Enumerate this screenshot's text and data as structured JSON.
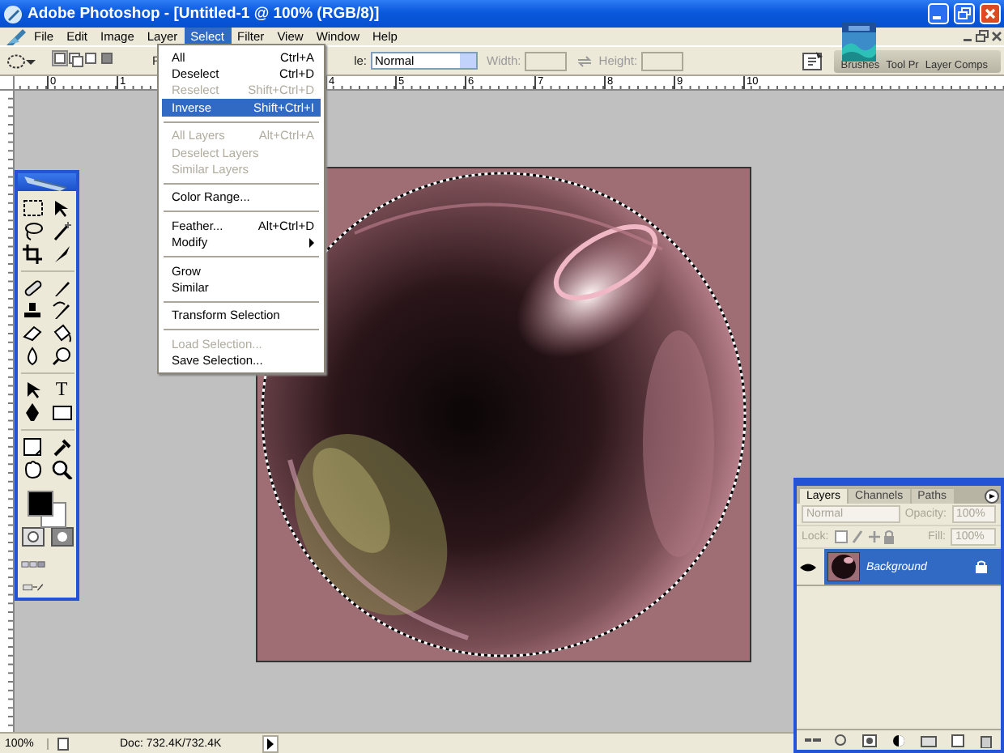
{
  "window": {
    "title": "Adobe Photoshop - [Untitled-1 @ 100% (RGB/8)]"
  },
  "menu_bar": [
    {
      "label": "File",
      "selected": false
    },
    {
      "label": "Edit",
      "selected": false
    },
    {
      "label": "Image",
      "selected": false
    },
    {
      "label": "Layer",
      "selected": false
    },
    {
      "label": "Select",
      "selected": true
    },
    {
      "label": "Filter",
      "selected": false
    },
    {
      "label": "View",
      "selected": false
    },
    {
      "label": "Window",
      "selected": false
    },
    {
      "label": "Help",
      "selected": false
    }
  ],
  "select_menu": [
    {
      "kind": "item",
      "label": "All",
      "shortcut": "Ctrl+A",
      "disabled": false,
      "selected": false
    },
    {
      "kind": "item",
      "label": "Deselect",
      "shortcut": "Ctrl+D",
      "disabled": false,
      "selected": false
    },
    {
      "kind": "item",
      "label": "Reselect",
      "shortcut": "Shift+Ctrl+D",
      "disabled": true,
      "selected": false
    },
    {
      "kind": "item",
      "label": "Inverse",
      "shortcut": "Shift+Ctrl+I",
      "disabled": false,
      "selected": true
    },
    {
      "kind": "separator"
    },
    {
      "kind": "item",
      "label": "All Layers",
      "shortcut": "Alt+Ctrl+A",
      "disabled": true,
      "selected": false
    },
    {
      "kind": "item",
      "label": "Deselect Layers",
      "disabled": true,
      "selected": false
    },
    {
      "kind": "item",
      "label": "Similar Layers",
      "disabled": true,
      "selected": false
    },
    {
      "kind": "separator"
    },
    {
      "kind": "item",
      "label": "Color Range...",
      "disabled": false,
      "selected": false
    },
    {
      "kind": "separator"
    },
    {
      "kind": "item",
      "label": "Feather...",
      "shortcut": "Alt+Ctrl+D",
      "disabled": false,
      "selected": false
    },
    {
      "kind": "item",
      "label": "Modify",
      "submenu": true,
      "disabled": false,
      "selected": false
    },
    {
      "kind": "separator"
    },
    {
      "kind": "item",
      "label": "Grow",
      "disabled": false,
      "selected": false
    },
    {
      "kind": "item",
      "label": "Similar",
      "disabled": false,
      "selected": false
    },
    {
      "kind": "separator"
    },
    {
      "kind": "item",
      "label": "Transform Selection",
      "disabled": false,
      "selected": false
    },
    {
      "kind": "separator"
    },
    {
      "kind": "item",
      "label": "Load Selection...",
      "disabled": true,
      "selected": false
    },
    {
      "kind": "item",
      "label": "Save Selection...",
      "disabled": false,
      "selected": false
    }
  ],
  "options_bar": {
    "feather_label": "F",
    "style_label": "le:",
    "style": "Normal",
    "width_label": "Width:",
    "height_label": "Height:",
    "palette_well": [
      "Brushes",
      "Tool Pr",
      "Layer Comps"
    ]
  },
  "ruler": {
    "marks": [
      {
        "kind": "label",
        "label": "0"
      },
      {
        "kind": "label",
        "label": "1"
      },
      {
        "kind": "covered"
      },
      {
        "kind": "covered"
      },
      {
        "kind": "label",
        "label": "4"
      },
      {
        "kind": "label",
        "label": "5"
      },
      {
        "kind": "label",
        "label": "6"
      },
      {
        "kind": "label",
        "label": "7"
      },
      {
        "kind": "label",
        "label": "8"
      },
      {
        "kind": "label",
        "label": "9"
      },
      {
        "kind": "label",
        "label": "10"
      }
    ]
  },
  "toolbox": {
    "type_tool_glyph": "T"
  },
  "layers_panel": {
    "tabs": [
      {
        "label": "Layers",
        "selected": true
      },
      {
        "label": "Channels",
        "selected": false
      },
      {
        "label": "Paths",
        "selected": false
      }
    ],
    "controls_disabled": true,
    "blend_mode": "Normal",
    "opacity_label": "Opacity:",
    "opacity": "100%",
    "lock_label": "Lock:",
    "fill_label": "Fill:",
    "fill": "100%",
    "layers": [
      {
        "name": "Background",
        "selected": true,
        "visible": true,
        "locked": true
      }
    ]
  },
  "status_bar": {
    "zoom": "100%",
    "doc_info": "Doc: 732.4K/732.4K"
  }
}
